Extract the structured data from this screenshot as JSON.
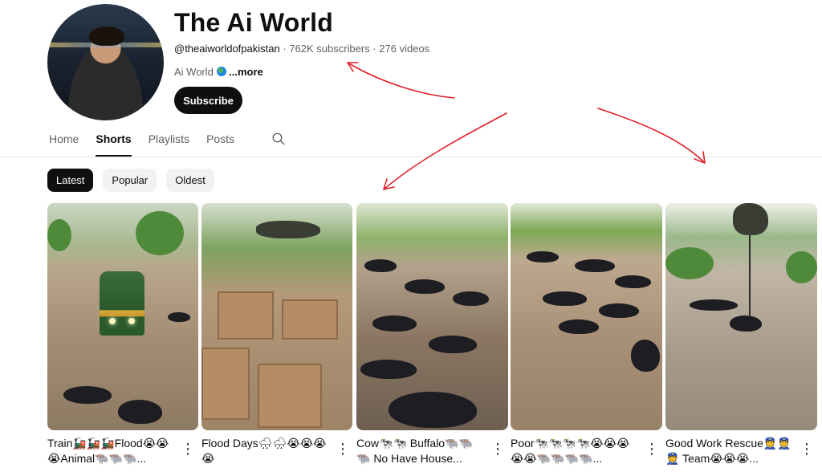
{
  "channel": {
    "name": "The Ai World",
    "handle": "@theaiworldofpakistan",
    "subscribers": "762K subscribers",
    "videos": "276 videos",
    "separator": " · ",
    "description": "Ai World",
    "more_label": "...more",
    "subscribe_label": "Subscribe"
  },
  "tabs": [
    {
      "label": "Home",
      "active": false
    },
    {
      "label": "Shorts",
      "active": true
    },
    {
      "label": "Playlists",
      "active": false
    },
    {
      "label": "Posts",
      "active": false
    }
  ],
  "filters": [
    {
      "label": "Latest",
      "active": true
    },
    {
      "label": "Popular",
      "active": false
    },
    {
      "label": "Oldest",
      "active": false
    }
  ],
  "shorts": [
    {
      "title": "Train🚂🚂🚂Flood😭😭😭Animal🐃🐃🐃..."
    },
    {
      "title": "Flood Days🌧🌧😭😭😭😭"
    },
    {
      "title": "Cow🐄🐄 Buffalo🐃🐃🐃 No Have House..."
    },
    {
      "title": "Poor🐄🐄🐄🐄😭😭😭😭😭🐃🐃🐃🐃..."
    },
    {
      "title": "Good Work Rescue👮👮👮 Team😭😭😭..."
    }
  ],
  "icons": {
    "search": "search-icon",
    "more_options": "more-vert-icon",
    "globe": "globe-icon"
  },
  "colors": {
    "annotation_arrow": "#e0202a",
    "active_chip": "#0f0f0f"
  }
}
